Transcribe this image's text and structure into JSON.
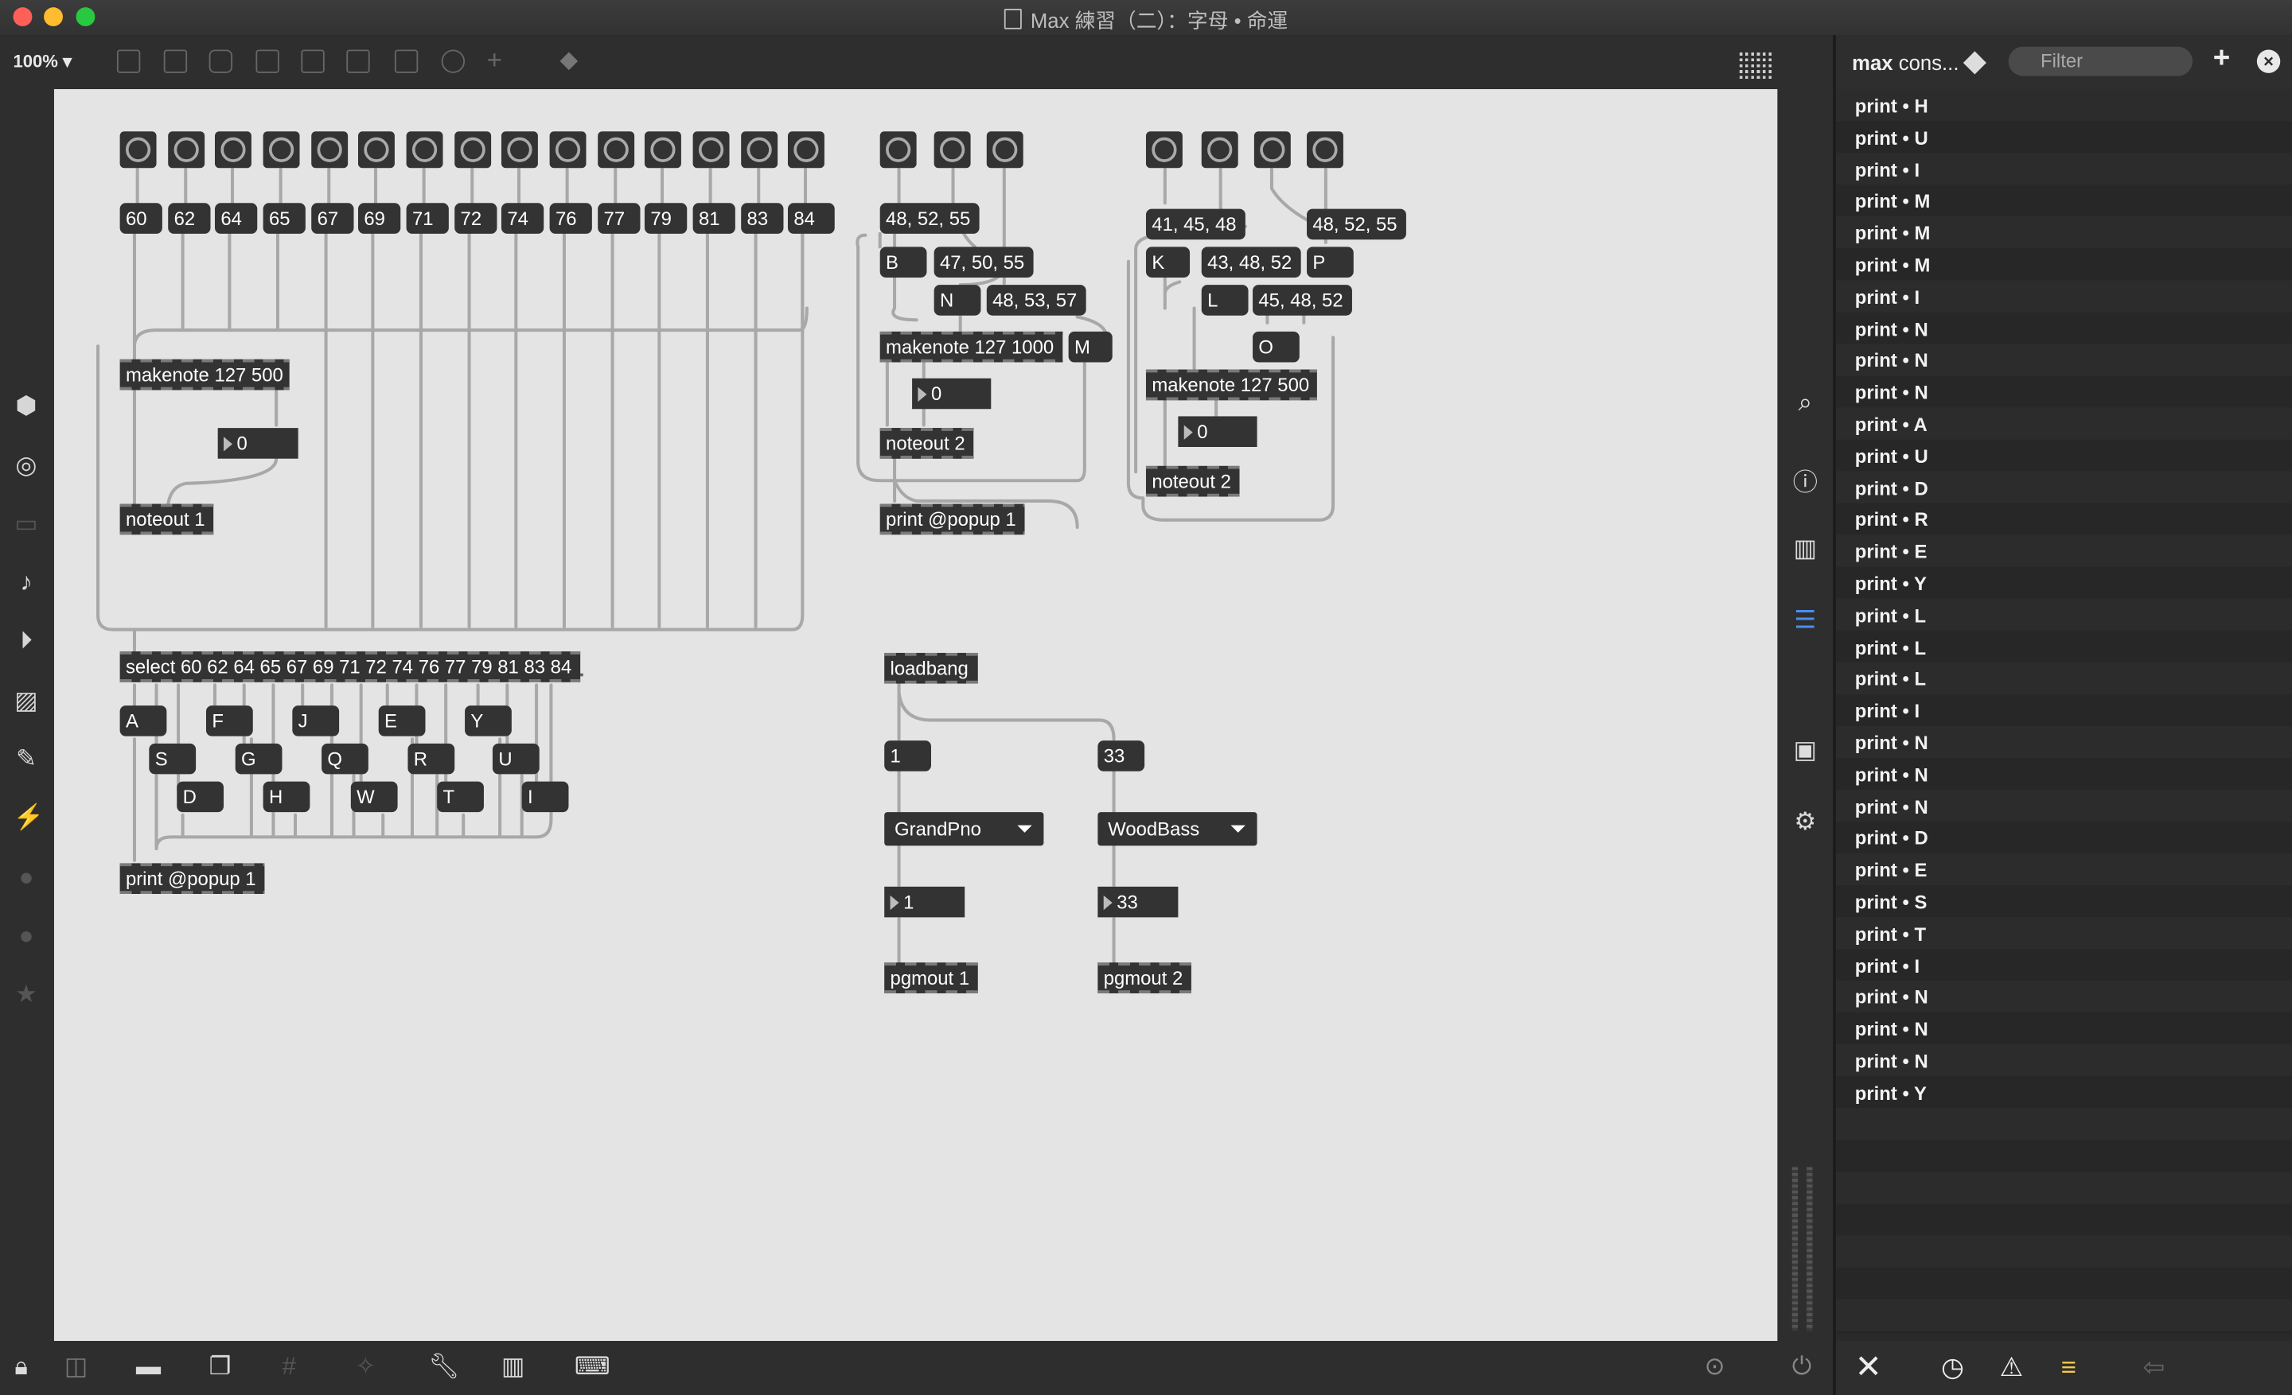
{
  "window": {
    "title": "Max 練習（二）：字母 • 命運"
  },
  "toolbar": {
    "zoom": "100%"
  },
  "console": {
    "title_bold": "max",
    "title_rest": " cons...",
    "filter_placeholder": "Filter",
    "add_label": "+",
    "close_label": "×",
    "rows": [
      "print • H",
      "print • U",
      "print • I",
      "print • M",
      "print • M",
      "print • M",
      "print • I",
      "print • N",
      "print • N",
      "print • N",
      "print • A",
      "print • U",
      "print • D",
      "print • R",
      "print • E",
      "print • Y",
      "print • L",
      "print • L",
      "print • L",
      "print • I",
      "print • N",
      "print • N",
      "print • N",
      "print • D",
      "print • E",
      "print • S",
      "print • T",
      "print • I",
      "print • N",
      "print • N",
      "print • N",
      "print • Y"
    ]
  },
  "patch": {
    "notes": [
      "60",
      "62",
      "64",
      "65",
      "67",
      "69",
      "71",
      "72",
      "74",
      "76",
      "77",
      "79",
      "81",
      "83",
      "84"
    ],
    "makenote1": "makenote 127 500",
    "number1": "0",
    "noteout1": "noteout 1",
    "select": "select 60 62 64 65 67 69 71 72 74 76 77 79 81 83 84",
    "letters_row1": [
      "A",
      "F",
      "J",
      "E",
      "Y"
    ],
    "letters_row2": [
      "S",
      "G",
      "Q",
      "R",
      "U"
    ],
    "letters_row3": [
      "D",
      "H",
      "W",
      "T",
      "I"
    ],
    "print1": "print @popup 1",
    "chord1": "48, 52, 55",
    "msgB": "B",
    "chord2": "47, 50, 55",
    "msgN": "N",
    "chord3": "48, 53, 57",
    "makenote2": "makenote 127 1000",
    "msgM": "M",
    "number2": "0",
    "noteout2a": "noteout 2",
    "print2": "print @popup 1",
    "chord4": "41, 45, 48",
    "chord5": "48, 52, 55",
    "msgK": "K",
    "chord6": "43, 48, 52",
    "msgP": "P",
    "msgL": "L",
    "chord7": "45, 48, 52",
    "msgO": "O",
    "makenote3": "makenote 127 500",
    "number3": "0",
    "noteout2b": "noteout 2",
    "loadbang": "loadbang",
    "msg1": "1",
    "msg33": "33",
    "menu1": "GrandPno",
    "menu2": "WoodBass",
    "num1": "1",
    "num33": "33",
    "pgmout1": "pgmout 1",
    "pgmout2": "pgmout 2"
  }
}
